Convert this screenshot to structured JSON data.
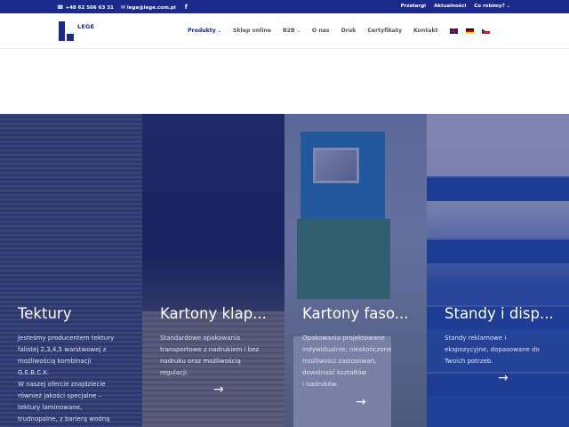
{
  "topbar": {
    "phone": "+48 62 506 63 31",
    "email": "lege@lege.com.pl",
    "facebook_icon": "facebook-icon",
    "links": [
      "Przetargi",
      "Aktualności",
      "Co robimy?"
    ]
  },
  "header": {
    "logo_text": "LEGE",
    "nav": [
      "Produkty",
      "Sklep online",
      "B2B",
      "O nas",
      "Druk",
      "Certyfikaty",
      "Kontakt"
    ],
    "languages": [
      "en",
      "de",
      "cs"
    ]
  },
  "colors": {
    "brand": "#1b2a8a",
    "overlay": "#16236e",
    "text_light": "#dfe3f2"
  },
  "cards": [
    {
      "title": "Tektury",
      "desc": [
        "Jesteśmy producentem tektury",
        "falistej 2,3,4,5 warstwowej z",
        "możliwością kombinacji",
        "G.E.B.C.K.",
        "W naszej ofercie znajdziecie",
        "również jakości specjalne –",
        "tektury laminowane,",
        "trudnopalne, z barierą wodną"
      ]
    },
    {
      "title": "Kartony klap...",
      "desc": [
        "Standardowe opakowania",
        "transportowe z nadrukiem i bez",
        "nadruku oraz możliwością",
        "regulacji."
      ],
      "arrow": "→"
    },
    {
      "title": "Kartony faso...",
      "desc": [
        "Opakowania projektowane",
        "indywidualnie; nieskończone",
        "możliwości zastosowań,",
        "dowolność kształtów",
        "i nadruków."
      ],
      "arrow": "→"
    },
    {
      "title": "Standy i disp...",
      "desc": [
        "Standy reklamowe i",
        "ekspozycyjne, dopasowane do",
        "Twoich potrzeb."
      ],
      "arrow": "→"
    }
  ]
}
